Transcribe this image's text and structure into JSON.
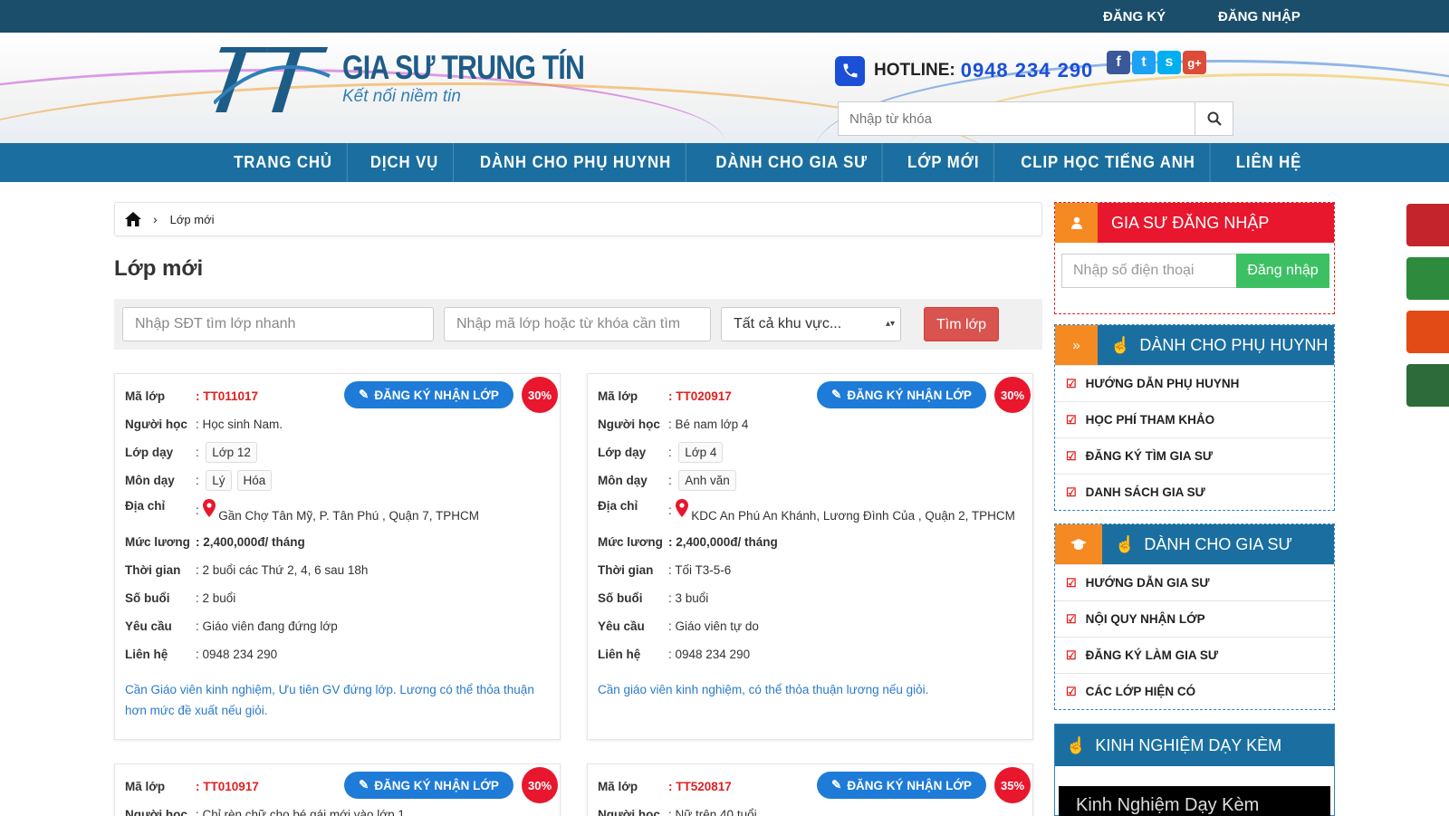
{
  "topbar": {
    "register": "ĐĂNG KÝ",
    "login": "ĐĂNG NHẬP"
  },
  "header": {
    "brand": "GIA SƯ TRUNG TÍN",
    "tagline": "Kết nối niềm tin",
    "hotline_label": "HOTLINE:",
    "hotline_number": "0948 234 290",
    "search_placeholder": "Nhập từ khóa",
    "socials": [
      "f",
      "t",
      "s",
      "g+"
    ]
  },
  "nav": [
    "TRANG CHỦ",
    "DỊCH VỤ",
    "DÀNH CHO PHỤ HUYNH",
    "DÀNH CHO GIA SƯ",
    "LỚP MỚI",
    "CLIP HỌC TIẾNG ANH",
    "LIÊN HỆ"
  ],
  "breadcrumb": {
    "current": "Lớp mới"
  },
  "page_title": "Lớp mới",
  "filter": {
    "phone_placeholder": "Nhập SĐT tìm lớp nhanh",
    "keyword_placeholder": "Nhập mã lớp hoặc từ khóa cần tìm",
    "area_selected": "Tất cả khu vực...",
    "search_button": "Tìm lớp"
  },
  "labels": {
    "code": "Mã lớp",
    "student": "Người học",
    "grade": "Lớp dạy",
    "subject": "Môn dạy",
    "address": "Địa chỉ",
    "salary": "Mức lương",
    "time": "Thời gian",
    "sessions": "Số buổi",
    "requirement": "Yêu cầu",
    "contact": "Liên hệ",
    "register_button": "ĐĂNG KÝ NHẬN LỚP"
  },
  "classes": [
    {
      "code": ": TT011017",
      "student": ": Học sinh Nam.",
      "grade": "Lớp 12",
      "subjects": [
        "Lý",
        "Hóa"
      ],
      "address": "Gần Chợ Tân Mỹ, P. Tân Phú , Quận 7, TPHCM",
      "salary": ": 2,400,000đ/ tháng",
      "time": ": 2 buổi các Thứ 2, 4, 6 sau 18h",
      "sessions": ": 2 buổi",
      "requirement": ": Giáo viên đang đứng lớp",
      "contact": ": 0948 234 290",
      "note": "Cần Giáo viên kinh nghiệm, Ưu tiên GV đứng lớp. Lương có thể thỏa thuận hơn mức đề xuất nếu giỏi.",
      "fee": "30%"
    },
    {
      "code": ": TT020917",
      "student": ": Bé nam lớp 4",
      "grade": "Lớp 4",
      "subjects": [
        "Anh văn"
      ],
      "address": "KDC An Phú An Khánh, Lương Đình Của , Quận 2, TPHCM",
      "salary": ": 2,400,000đ/ tháng",
      "time": ": Tối T3-5-6",
      "sessions": ": 3 buổi",
      "requirement": ": Giáo viên tự do",
      "contact": ": 0948 234 290",
      "note": "Cần giáo viên kinh nghiệm, có thể thỏa thuận lương nếu giỏi.",
      "fee": "30%"
    },
    {
      "code": ": TT010917",
      "student": ": Chỉ rèn chữ cho bé gái mới vào lớp 1",
      "fee": "30%"
    },
    {
      "code": ": TT520817",
      "student": ": Nữ trên 40 tuổi",
      "fee": "35%"
    }
  ],
  "sidebar": {
    "login_title": "GIA SƯ ĐĂNG NHẬP",
    "phone_placeholder": "Nhập số điện thoại",
    "login_button": "Đăng nhập",
    "parents_title": "DÀNH CHO PHỤ HUYNH",
    "parents_items": [
      "HƯỚNG DẪN PHỤ HUYNH",
      "HỌC PHÍ THAM KHẢO",
      "ĐĂNG KÝ TÌM GIA SƯ",
      "DANH SÁCH GIA SƯ"
    ],
    "tutors_title": "DÀNH CHO GIA SƯ",
    "tutors_items": [
      "HƯỚNG DẪN GIA SƯ",
      "NỘI QUY NHẬN LỚP",
      "ĐĂNG KÝ LÀM GIA SƯ",
      "CÁC LỚP HIỆN CÓ"
    ],
    "experience_title": "KINH NGHIỆM DẠY KÈM",
    "video_title": "Kinh Nghiệm Dạy Kèm"
  },
  "colors": {
    "nav": "#1a6fa0",
    "topbar": "#1b4e6b",
    "accent_red": "#e8172d",
    "accent_blue": "#1e7bd8",
    "orange": "#f58a22",
    "green": "#3cc063"
  }
}
